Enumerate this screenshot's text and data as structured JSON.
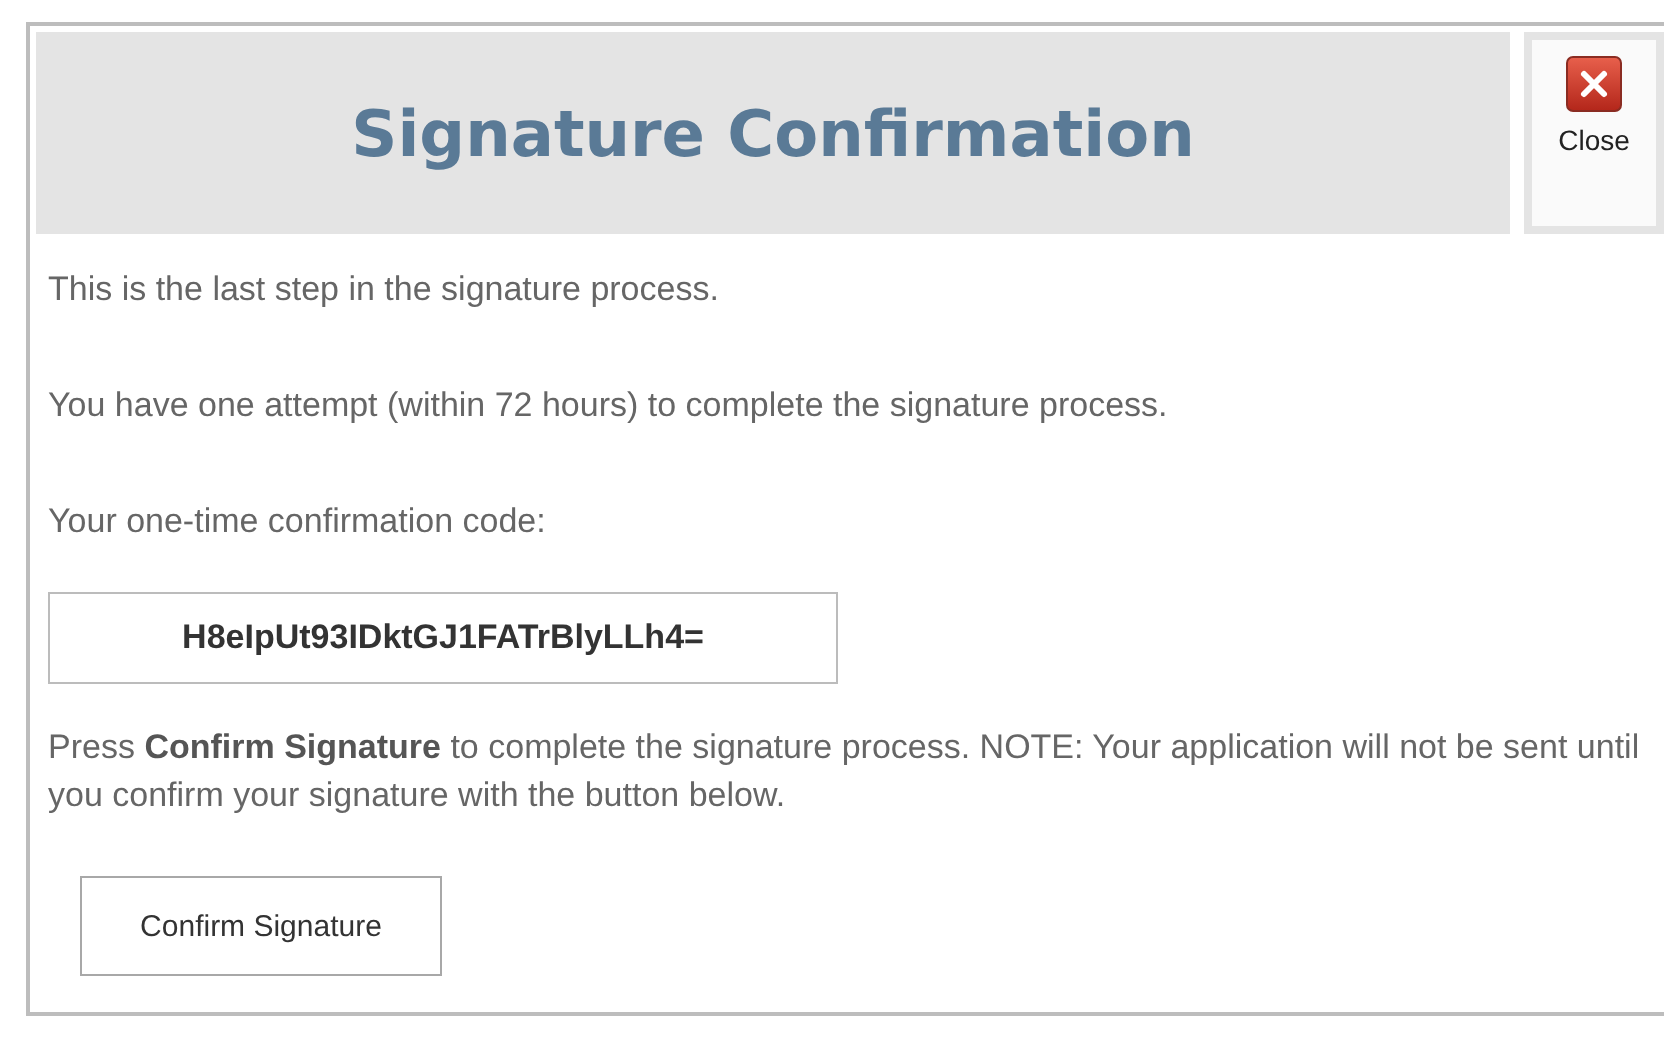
{
  "dialog": {
    "title": "Signature Confirmation",
    "close_label": "Close"
  },
  "paragraphs": [
    "This is the last step in the signature process.",
    "You have one attempt (within 72 hours) to complete the signature process.",
    "Your one-time confirmation code:"
  ],
  "code": "H8eIpUt93IDktGJ1FATrBlyLLh4=",
  "note": "Press **Confirm Signature** to complete the signature process.  NOTE: Your application will not be sent until you confirm your signature with the button below.",
  "button": "Confirm Signature"
}
